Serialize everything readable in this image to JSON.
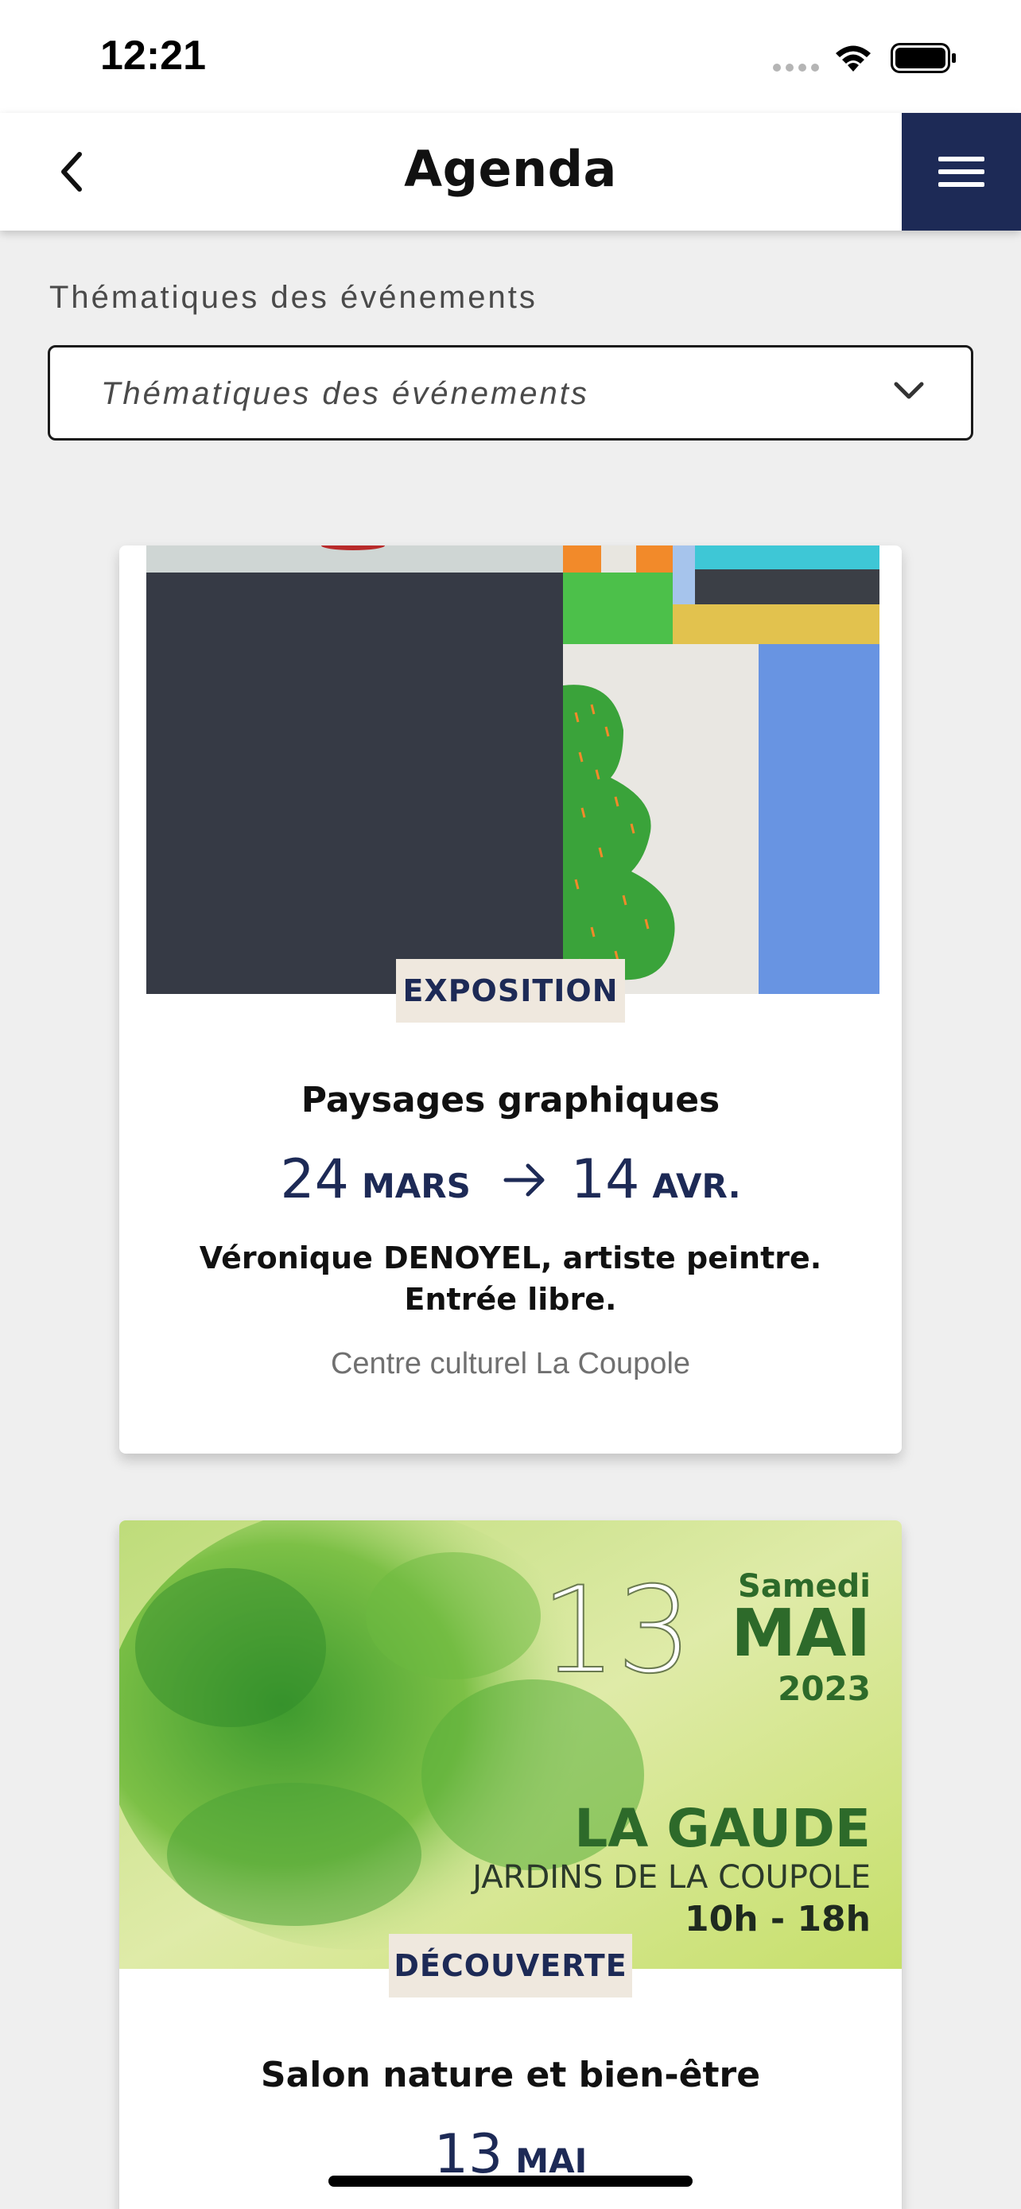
{
  "status_bar": {
    "time": "12:21"
  },
  "header": {
    "title": "Agenda"
  },
  "filter": {
    "label": "Thématiques des événements",
    "placeholder": "Thématiques des événements"
  },
  "events": [
    {
      "category": "EXPOSITION",
      "title": "Paysages graphiques",
      "start_day": "24",
      "start_month": "MARS",
      "end_day": "14",
      "end_month": "AVR.",
      "description_line1": "Véronique DENOYEL, artiste peintre.",
      "description_line2": "Entrée libre.",
      "venue": "Centre culturel La Coupole"
    },
    {
      "category": "DÉCOUVERTE",
      "title": "Salon nature et bien-être",
      "day": "13",
      "month": "MAI",
      "poster": {
        "day": "13",
        "weekday": "Samedi",
        "month": "MAI",
        "year": "2023",
        "town": "LA GAUDE",
        "place": "JARDINS DE LA COUPOLE",
        "hours": "10h - 18h"
      }
    }
  ],
  "colors": {
    "navy": "#1d2a56",
    "tag_bg": "#efe8de",
    "page_bg": "#efefef"
  }
}
